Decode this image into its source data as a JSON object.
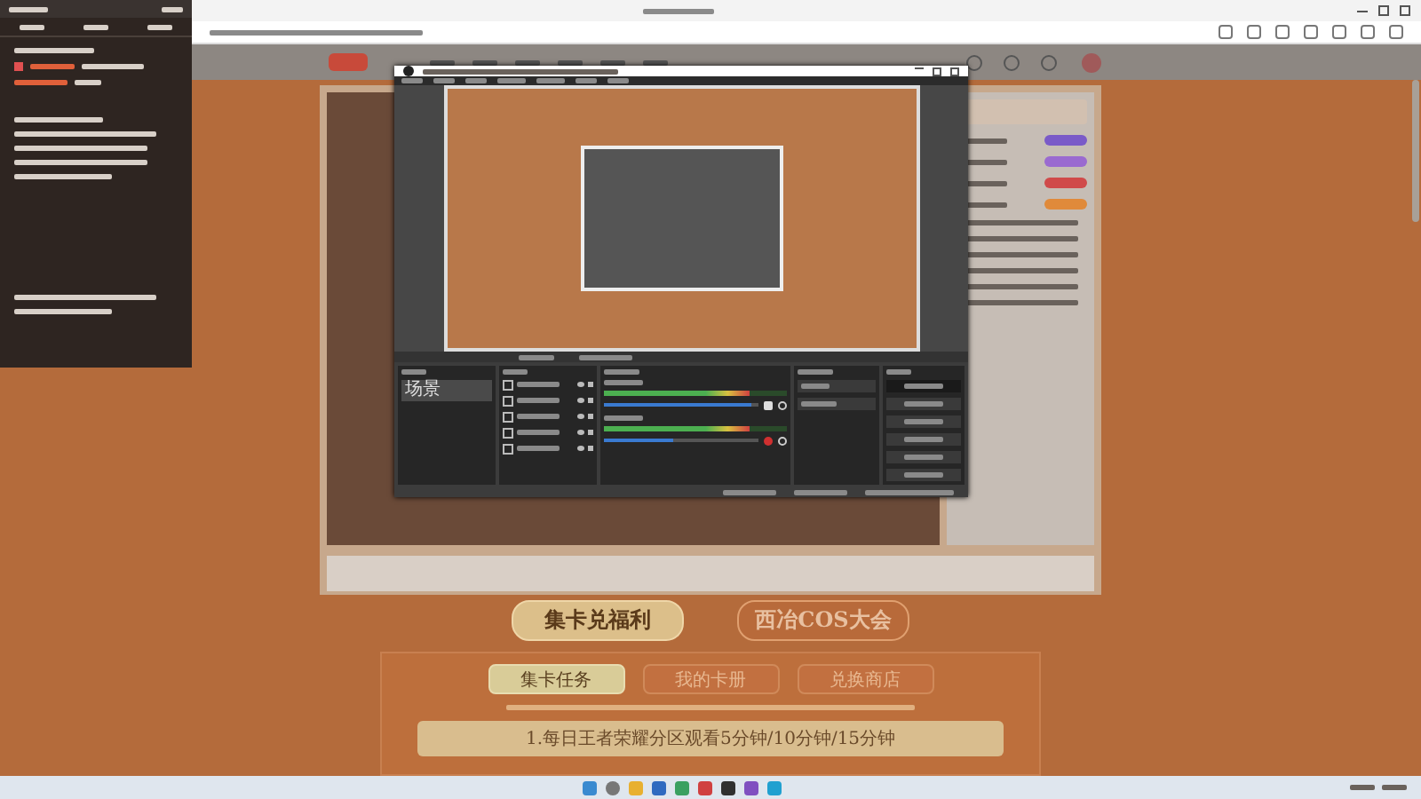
{
  "obs": {
    "scenes": [
      {
        "label": "场景",
        "selected": true
      }
    ],
    "mixer": [
      {
        "level": 0.95,
        "muted": false
      },
      {
        "level": 0.45,
        "muted": true
      }
    ]
  },
  "page": {
    "banners": [
      {
        "label": "集卡兑福利",
        "selected": true
      },
      {
        "label": "西冶COS大会",
        "selected": false
      }
    ],
    "tabs": [
      {
        "label": "集卡任务",
        "selected": true
      },
      {
        "label": "我的卡册",
        "selected": false
      },
      {
        "label": "兑换商店",
        "selected": false
      }
    ],
    "tasks": [
      "1.每日王者荣耀分区观看5分钟/10分钟/15分钟"
    ]
  }
}
